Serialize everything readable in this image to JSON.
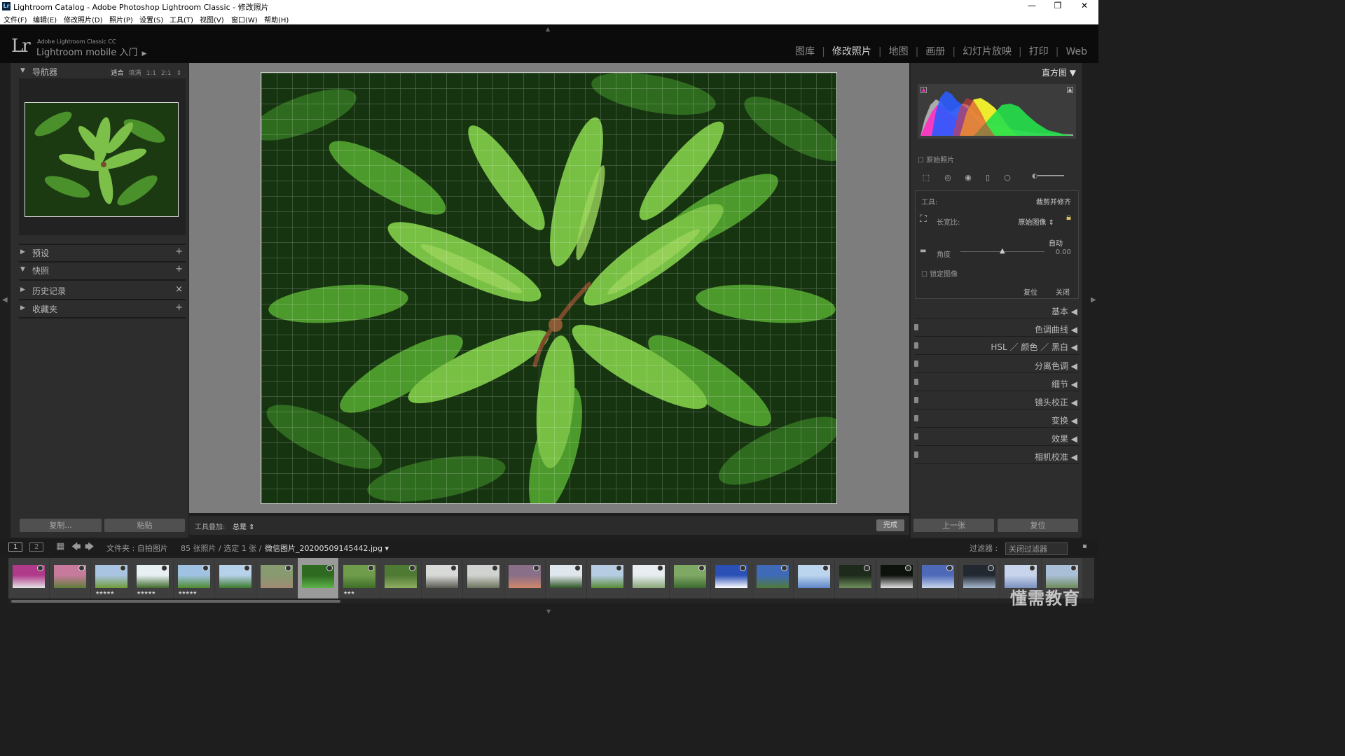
{
  "window": {
    "title": "Lightroom Catalog - Adobe Photoshop Lightroom Classic - 修改照片",
    "app_icon": "Lr",
    "minimize": "—",
    "maximize": "❐",
    "close": "✕"
  },
  "menu": [
    "文件(F)",
    "编辑(E)",
    "修改照片(D)",
    "照片(P)",
    "设置(S)",
    "工具(T)",
    "视图(V)",
    "窗口(W)",
    "帮助(H)"
  ],
  "identity": {
    "logo": "Lr",
    "brand": "Adobe Lightroom Classic CC",
    "mobile": "Lightroom mobile 入门",
    "mobile_arrow": "▶"
  },
  "modules": [
    "图库",
    "修改照片",
    "地图",
    "画册",
    "幻灯片放映",
    "打印",
    "Web"
  ],
  "modules_active": "修改照片",
  "left_panel": {
    "navigator": {
      "title": "导航器",
      "zoom": [
        "适合",
        "填满",
        "1:1",
        "2:1"
      ],
      "zoom_arrow": "⇕"
    },
    "sections": [
      {
        "label": "预设",
        "tri": "▶",
        "action": "+"
      },
      {
        "label": "快照",
        "tri": "▼",
        "action": "+"
      },
      {
        "label": "历史记录",
        "tri": "▶",
        "action": "×"
      },
      {
        "label": "收藏夹",
        "tri": "▶",
        "action": "+"
      }
    ],
    "copy_button": "复制...",
    "paste_button": "粘贴"
  },
  "toolbar": {
    "overlay_label": "工具叠加:",
    "overlay_value": "总是 ⇕",
    "done_button": "完成"
  },
  "right_panel": {
    "histogram_title": "直方图 ▼",
    "original_photo": "原始照片",
    "crop": {
      "tool_label": "工具:",
      "tool_name": "裁剪并修齐",
      "aspect_label": "长宽比:",
      "aspect_value": "原始图像 ⇕",
      "auto": "自动",
      "angle_label": "角度",
      "angle_value": "0.00",
      "angle_fraction": 0.5,
      "constrain": "锁定图像",
      "reset": "复位",
      "close": "关闭"
    },
    "sections": [
      {
        "label": "基本 ◀",
        "toggle": false
      },
      {
        "label": "色调曲线 ◀",
        "toggle": true
      },
      {
        "label": "HSL ／ 颜色 ／ 黑白 ◀",
        "toggle": true
      },
      {
        "label": "分离色调 ◀",
        "toggle": true
      },
      {
        "label": "细节 ◀",
        "toggle": true
      },
      {
        "label": "镜头校正 ◀",
        "toggle": true
      },
      {
        "label": "变换 ◀",
        "toggle": true
      },
      {
        "label": "效果 ◀",
        "toggle": true
      },
      {
        "label": "相机校准 ◀",
        "toggle": true
      }
    ],
    "prev_button": "上一张",
    "reset_button": "复位"
  },
  "filmstrip_bar": {
    "view1": "1",
    "view2": "2",
    "path": "文件夹 : 自拍图片",
    "count": "85 张照片 / 选定 1 张 /",
    "filename": "微信图片_20200509145442.jpg ▾",
    "filter_label": "过滤器 :",
    "filter_value": "关闭过滤器"
  },
  "filmstrip": {
    "thumbs": [
      {
        "c1": "#b03a8a",
        "c2": "#e4e4e4",
        "stars": ""
      },
      {
        "c1": "#c77a9b",
        "c2": "#5f7d3a",
        "stars": ""
      },
      {
        "c1": "#a9c4e0",
        "c2": "#6f9c3c",
        "stars": "★★★★★"
      },
      {
        "c1": "#e8f0f4",
        "c2": "#3f6a2a",
        "stars": "★★★★★"
      },
      {
        "c1": "#9fc2e2",
        "c2": "#4d8a2e",
        "stars": "★★★★★"
      },
      {
        "c1": "#b6d1ea",
        "c2": "#3b7a2b",
        "stars": ""
      },
      {
        "c1": "#879a70",
        "c2": "#a08a73",
        "stars": ""
      },
      {
        "c1": "#2e6a20",
        "c2": "#5db24a",
        "stars": ""
      },
      {
        "c1": "#6e9c4a",
        "c2": "#3f6e2a",
        "stars": "★★★"
      },
      {
        "c1": "#4f7a34",
        "c2": "#8fae62",
        "stars": ""
      },
      {
        "c1": "#d8dad8",
        "c2": "#5a5a52",
        "stars": ""
      },
      {
        "c1": "#d0d3cf",
        "c2": "#6d745e",
        "stars": ""
      },
      {
        "c1": "#8a6f89",
        "c2": "#d1876a",
        "stars": ""
      },
      {
        "c1": "#dfe6ec",
        "c2": "#2f5526",
        "stars": ""
      },
      {
        "c1": "#b5cce2",
        "c2": "#578b35",
        "stars": ""
      },
      {
        "c1": "#e7edf0",
        "c2": "#8aa878",
        "stars": ""
      },
      {
        "c1": "#7fa865",
        "c2": "#3b6a30",
        "stars": ""
      },
      {
        "c1": "#2a4fb5",
        "c2": "#ffffff",
        "stars": ""
      },
      {
        "c1": "#3f6ab8",
        "c2": "#4f7a3a",
        "stars": ""
      },
      {
        "c1": "#bcd5ef",
        "c2": "#5f87c8",
        "stars": ""
      },
      {
        "c1": "#1d2a1c",
        "c2": "#6f8f5c",
        "stars": ""
      },
      {
        "c1": "#0d120d",
        "c2": "#e0e0e0",
        "stars": ""
      },
      {
        "c1": "#4e69b8",
        "c2": "#c9d6ee",
        "stars": ""
      },
      {
        "c1": "#222830",
        "c2": "#a6b9d0",
        "stars": ""
      },
      {
        "c1": "#c7d4ec",
        "c2": "#7b90bd",
        "stars": ""
      },
      {
        "c1": "#a9bfd8",
        "c2": "#6f8a5a",
        "stars": ""
      }
    ]
  },
  "watermark": "懂需教育",
  "edge_arrows": {
    "left": "◀",
    "right": "▶",
    "top": "▲",
    "bottom": "▼"
  }
}
